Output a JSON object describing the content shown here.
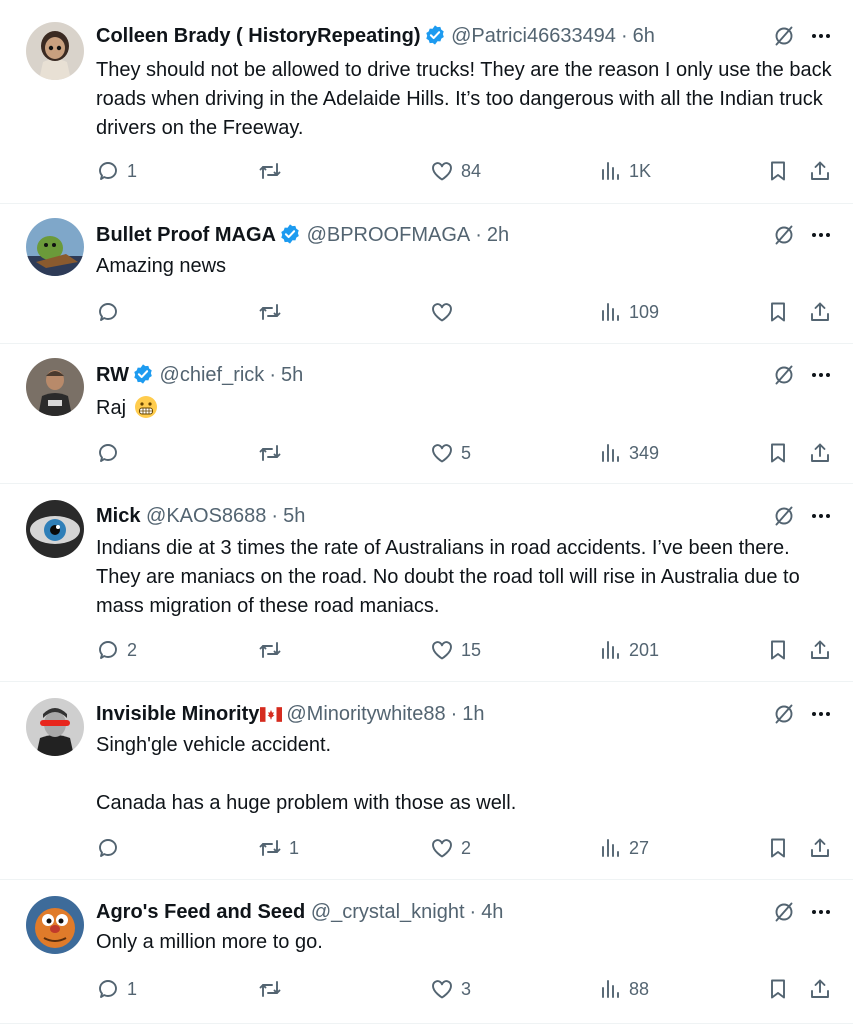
{
  "tweets": [
    {
      "name": "Colleen Brady ( HistoryRepeating)",
      "verified": true,
      "handle": "@Patrici46633494",
      "separator": "·",
      "time": "6h",
      "text": [
        "They should not be allowed to drive trucks! They are the reason I only use the back roads when driving in the Adelaide Hills. It’s too dangerous with all the Indian truck drivers on the Freeway."
      ],
      "replies": "1",
      "reposts": "",
      "likes": "84",
      "views": "1K"
    },
    {
      "name": "Bullet Proof MAGA",
      "verified": true,
      "handle": "@BPROOFMAGA",
      "separator": "·",
      "time": "2h",
      "text": [
        "Amazing news"
      ],
      "replies": "",
      "reposts": "",
      "likes": "",
      "views": "109"
    },
    {
      "name": "RW",
      "verified": true,
      "handle": "@chief_rick",
      "separator": "·",
      "time": "5h",
      "text": [
        "Raj"
      ],
      "emoji": "grimacing-face",
      "replies": "",
      "reposts": "",
      "likes": "5",
      "views": "349"
    },
    {
      "name": "Mick",
      "verified": false,
      "handle": "@KAOS8688",
      "separator": "·",
      "time": "5h",
      "text": [
        "Indians die at 3 times the rate of Australians in road accidents. I’ve been there. They are maniacs on the road. No doubt the road toll will rise in Australia due to mass migration of these road maniacs."
      ],
      "replies": "2",
      "reposts": "",
      "likes": "15",
      "views": "201"
    },
    {
      "name": "Invisible Minority",
      "verified": false,
      "flag": "canada-flag",
      "handle": "@Minoritywhite88",
      "separator": "·",
      "time": "1h",
      "text": [
        "Singh'gle vehicle accident.",
        "Canada has a huge problem with those as well."
      ],
      "replies": "",
      "reposts": "1",
      "likes": "2",
      "views": "27"
    },
    {
      "name": "Agro's Feed and Seed",
      "verified": false,
      "handle": "@_crystal_knight",
      "separator": "·",
      "time": "4h",
      "text": [
        "Only a million more to go."
      ],
      "replies": "1",
      "reposts": "",
      "likes": "3",
      "views": "88"
    }
  ],
  "colors": {
    "text": "#0f1419",
    "secondary": "#536471",
    "verified_badge": "#1d9bf0",
    "divider": "#eff3f4"
  },
  "icons": [
    "reply-icon",
    "repost-icon",
    "like-icon",
    "views-icon",
    "bookmark-icon",
    "share-icon",
    "grok-icon",
    "more-icon",
    "verified-badge-icon"
  ]
}
